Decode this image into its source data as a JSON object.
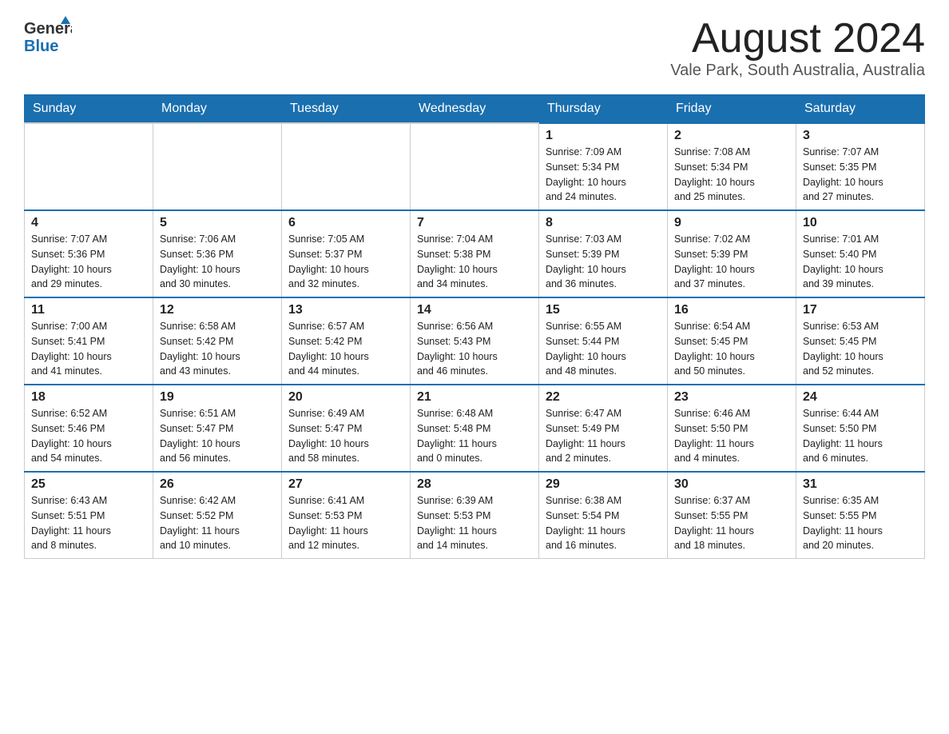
{
  "header": {
    "logo_general": "General",
    "logo_blue": "Blue",
    "month_title": "August 2024",
    "location": "Vale Park, South Australia, Australia"
  },
  "weekdays": [
    "Sunday",
    "Monday",
    "Tuesday",
    "Wednesday",
    "Thursday",
    "Friday",
    "Saturday"
  ],
  "weeks": [
    [
      {
        "day": "",
        "info": ""
      },
      {
        "day": "",
        "info": ""
      },
      {
        "day": "",
        "info": ""
      },
      {
        "day": "",
        "info": ""
      },
      {
        "day": "1",
        "info": "Sunrise: 7:09 AM\nSunset: 5:34 PM\nDaylight: 10 hours\nand 24 minutes."
      },
      {
        "day": "2",
        "info": "Sunrise: 7:08 AM\nSunset: 5:34 PM\nDaylight: 10 hours\nand 25 minutes."
      },
      {
        "day": "3",
        "info": "Sunrise: 7:07 AM\nSunset: 5:35 PM\nDaylight: 10 hours\nand 27 minutes."
      }
    ],
    [
      {
        "day": "4",
        "info": "Sunrise: 7:07 AM\nSunset: 5:36 PM\nDaylight: 10 hours\nand 29 minutes."
      },
      {
        "day": "5",
        "info": "Sunrise: 7:06 AM\nSunset: 5:36 PM\nDaylight: 10 hours\nand 30 minutes."
      },
      {
        "day": "6",
        "info": "Sunrise: 7:05 AM\nSunset: 5:37 PM\nDaylight: 10 hours\nand 32 minutes."
      },
      {
        "day": "7",
        "info": "Sunrise: 7:04 AM\nSunset: 5:38 PM\nDaylight: 10 hours\nand 34 minutes."
      },
      {
        "day": "8",
        "info": "Sunrise: 7:03 AM\nSunset: 5:39 PM\nDaylight: 10 hours\nand 36 minutes."
      },
      {
        "day": "9",
        "info": "Sunrise: 7:02 AM\nSunset: 5:39 PM\nDaylight: 10 hours\nand 37 minutes."
      },
      {
        "day": "10",
        "info": "Sunrise: 7:01 AM\nSunset: 5:40 PM\nDaylight: 10 hours\nand 39 minutes."
      }
    ],
    [
      {
        "day": "11",
        "info": "Sunrise: 7:00 AM\nSunset: 5:41 PM\nDaylight: 10 hours\nand 41 minutes."
      },
      {
        "day": "12",
        "info": "Sunrise: 6:58 AM\nSunset: 5:42 PM\nDaylight: 10 hours\nand 43 minutes."
      },
      {
        "day": "13",
        "info": "Sunrise: 6:57 AM\nSunset: 5:42 PM\nDaylight: 10 hours\nand 44 minutes."
      },
      {
        "day": "14",
        "info": "Sunrise: 6:56 AM\nSunset: 5:43 PM\nDaylight: 10 hours\nand 46 minutes."
      },
      {
        "day": "15",
        "info": "Sunrise: 6:55 AM\nSunset: 5:44 PM\nDaylight: 10 hours\nand 48 minutes."
      },
      {
        "day": "16",
        "info": "Sunrise: 6:54 AM\nSunset: 5:45 PM\nDaylight: 10 hours\nand 50 minutes."
      },
      {
        "day": "17",
        "info": "Sunrise: 6:53 AM\nSunset: 5:45 PM\nDaylight: 10 hours\nand 52 minutes."
      }
    ],
    [
      {
        "day": "18",
        "info": "Sunrise: 6:52 AM\nSunset: 5:46 PM\nDaylight: 10 hours\nand 54 minutes."
      },
      {
        "day": "19",
        "info": "Sunrise: 6:51 AM\nSunset: 5:47 PM\nDaylight: 10 hours\nand 56 minutes."
      },
      {
        "day": "20",
        "info": "Sunrise: 6:49 AM\nSunset: 5:47 PM\nDaylight: 10 hours\nand 58 minutes."
      },
      {
        "day": "21",
        "info": "Sunrise: 6:48 AM\nSunset: 5:48 PM\nDaylight: 11 hours\nand 0 minutes."
      },
      {
        "day": "22",
        "info": "Sunrise: 6:47 AM\nSunset: 5:49 PM\nDaylight: 11 hours\nand 2 minutes."
      },
      {
        "day": "23",
        "info": "Sunrise: 6:46 AM\nSunset: 5:50 PM\nDaylight: 11 hours\nand 4 minutes."
      },
      {
        "day": "24",
        "info": "Sunrise: 6:44 AM\nSunset: 5:50 PM\nDaylight: 11 hours\nand 6 minutes."
      }
    ],
    [
      {
        "day": "25",
        "info": "Sunrise: 6:43 AM\nSunset: 5:51 PM\nDaylight: 11 hours\nand 8 minutes."
      },
      {
        "day": "26",
        "info": "Sunrise: 6:42 AM\nSunset: 5:52 PM\nDaylight: 11 hours\nand 10 minutes."
      },
      {
        "day": "27",
        "info": "Sunrise: 6:41 AM\nSunset: 5:53 PM\nDaylight: 11 hours\nand 12 minutes."
      },
      {
        "day": "28",
        "info": "Sunrise: 6:39 AM\nSunset: 5:53 PM\nDaylight: 11 hours\nand 14 minutes."
      },
      {
        "day": "29",
        "info": "Sunrise: 6:38 AM\nSunset: 5:54 PM\nDaylight: 11 hours\nand 16 minutes."
      },
      {
        "day": "30",
        "info": "Sunrise: 6:37 AM\nSunset: 5:55 PM\nDaylight: 11 hours\nand 18 minutes."
      },
      {
        "day": "31",
        "info": "Sunrise: 6:35 AM\nSunset: 5:55 PM\nDaylight: 11 hours\nand 20 minutes."
      }
    ]
  ]
}
